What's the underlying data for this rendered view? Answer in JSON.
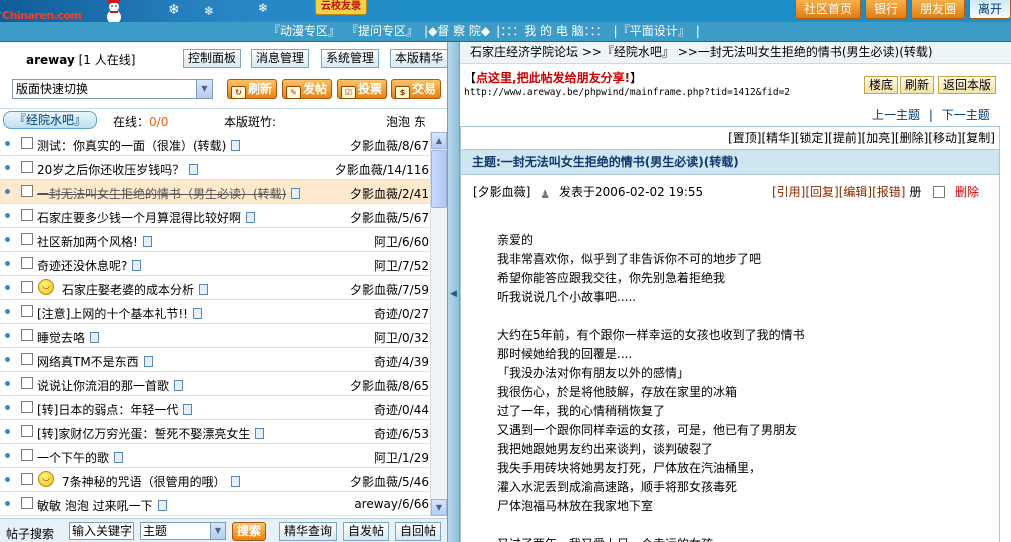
{
  "banner": {
    "logo_text": "Chinaren.com",
    "sign_text": "云校友录",
    "nav": [
      "社区首页",
      "银行",
      "朋友圈",
      "离开"
    ]
  },
  "menubar": {
    "items": [
      "『动漫专区』",
      "『提问专区』",
      "|◆督 察 院◆",
      "|：：：我 的 电 脑：：：",
      "|『平面设计』",
      "|"
    ]
  },
  "left": {
    "user": {
      "name": "areway",
      "online": "[1 人在线]"
    },
    "controls": [
      "控制面板",
      "消息管理",
      "系统管理",
      "本版精华"
    ],
    "quick_select": "版面快速切换",
    "actions": [
      {
        "label": "刷新",
        "icon": "refresh-icon"
      },
      {
        "label": "发帖",
        "icon": "new-post-icon"
      },
      {
        "label": "投票",
        "icon": "vote-icon"
      },
      {
        "label": "交易",
        "icon": "trade-icon"
      }
    ],
    "header": {
      "tab": "『经院水吧』",
      "online_label": "在线：",
      "online_value": "0/0",
      "moderator_label": "本版斑竹:",
      "moderators": "泡泡 东"
    },
    "threads": [
      {
        "title": "测试：你真实的一面（很准）(转载)",
        "meta": "夕影血薇/8/67",
        "smiley": false,
        "selected": false
      },
      {
        "title": "20岁之后你还收压岁钱吗？",
        "meta": "夕影血薇/14/116",
        "smiley": false,
        "selected": false
      },
      {
        "title": "一封无法叫女生拒绝的情书（男生必读）(转载)",
        "meta": "夕影血薇/2/41",
        "smiley": false,
        "selected": true
      },
      {
        "title": "石家庄要多少钱一个月算混得比较好啊",
        "meta": "夕影血薇/5/67",
        "smiley": false,
        "selected": false
      },
      {
        "title": "社区新加两个风格!",
        "meta": "阿卫/6/60",
        "smiley": false,
        "selected": false
      },
      {
        "title": "奇迹还没休息呢?",
        "meta": "阿卫/7/52",
        "smiley": false,
        "selected": false
      },
      {
        "title": "石家庄娶老婆的成本分析",
        "meta": "夕影血薇/7/59",
        "smiley": true,
        "selected": false
      },
      {
        "title": "[注意]上网的十个基本礼节!!",
        "meta": "奇迹/0/27",
        "smiley": false,
        "selected": false
      },
      {
        "title": "睡觉去咯",
        "meta": "阿卫/0/32",
        "smiley": false,
        "selected": false
      },
      {
        "title": "网络真TM不是东西",
        "meta": "奇迹/4/39",
        "smiley": false,
        "selected": false
      },
      {
        "title": "说说让你流泪的那一首歌",
        "meta": "夕影血薇/8/65",
        "smiley": false,
        "selected": false
      },
      {
        "title": "[转]日本的弱点：年轻一代",
        "meta": "奇迹/0/44",
        "smiley": false,
        "selected": false
      },
      {
        "title": "[转]家财亿万穷光蛋：誓死不娶漂亮女生",
        "meta": "奇迹/6/53",
        "smiley": false,
        "selected": false
      },
      {
        "title": "一个下午的歌",
        "meta": "阿卫/1/29",
        "smiley": false,
        "selected": false
      },
      {
        "title": "7条神秘的咒语（很管用的哦）",
        "meta": "夕影血薇/5/46",
        "smiley": true,
        "selected": false
      },
      {
        "title": "敏敏 泡泡 过来吼一下",
        "meta": "areway/6/66",
        "smiley": false,
        "selected": false
      }
    ],
    "search": {
      "label": "帖子搜索",
      "input_value": "输入关键字",
      "field_select": "主题",
      "search_button": "搜索",
      "buttons": [
        "精华查询",
        "自发帖",
        "自回帖"
      ]
    }
  },
  "right": {
    "breadcrumb": "石家庄经济学院论坛 >>『经院水吧』 >>一封无法叫女生拒绝的情书(男生必读)(转载)",
    "share_text": "点这里,把此帖发给朋友分享!",
    "url": "http://www.areway.be/phpwind/mainframe.php?tid=1412&fid=2",
    "buttons": [
      "楼底",
      "刷新",
      "返回本版"
    ],
    "prev_topic": "上一主题",
    "separator": "|",
    "next_topic": "下一主题",
    "actions": "[置顶][精华][锁定][提前][加亮][删除][移动][复制]",
    "subject": "主题:一封无法叫女生拒绝的情书(男生必读)(转载)",
    "author": "[夕影血薇]",
    "posted": "发表于2006-02-02 19:55",
    "tools": [
      "[引用]",
      "[回复]",
      "[编辑]",
      "[报错]",
      "册"
    ],
    "delete_label": "删除",
    "body": [
      "亲爱的",
      "我非常喜欢你，似乎到了非告诉你不可的地步了吧",
      "希望你能答应跟我交往，你先别急着拒绝我",
      "听我说说几个小故事吧.....",
      "",
      "大约在5年前，有个跟你一样幸运的女孩也收到了我的情书",
      "那时候她给我的回覆是....",
      "「我没办法对你有朋友以外的感情」",
      "我很伤心，於是将他肢解，存放在家里的冰箱",
      "过了一年，我的心情稍稍恢复了",
      "又遇到一个跟你同样幸运的女孩，可是，他已有了男朋友",
      "我把她跟她男友约出来谈判，谈判破裂了",
      "我失手用砖块将她男友打死，尸体放在汽油桶里，",
      "灌入水泥丢到成渝高速路，顺手将那女孩毒死",
      "尸体泡福马林放在我家地下室",
      "",
      "又过了两年，我又爱上另一个幸运的女孩"
    ]
  }
}
